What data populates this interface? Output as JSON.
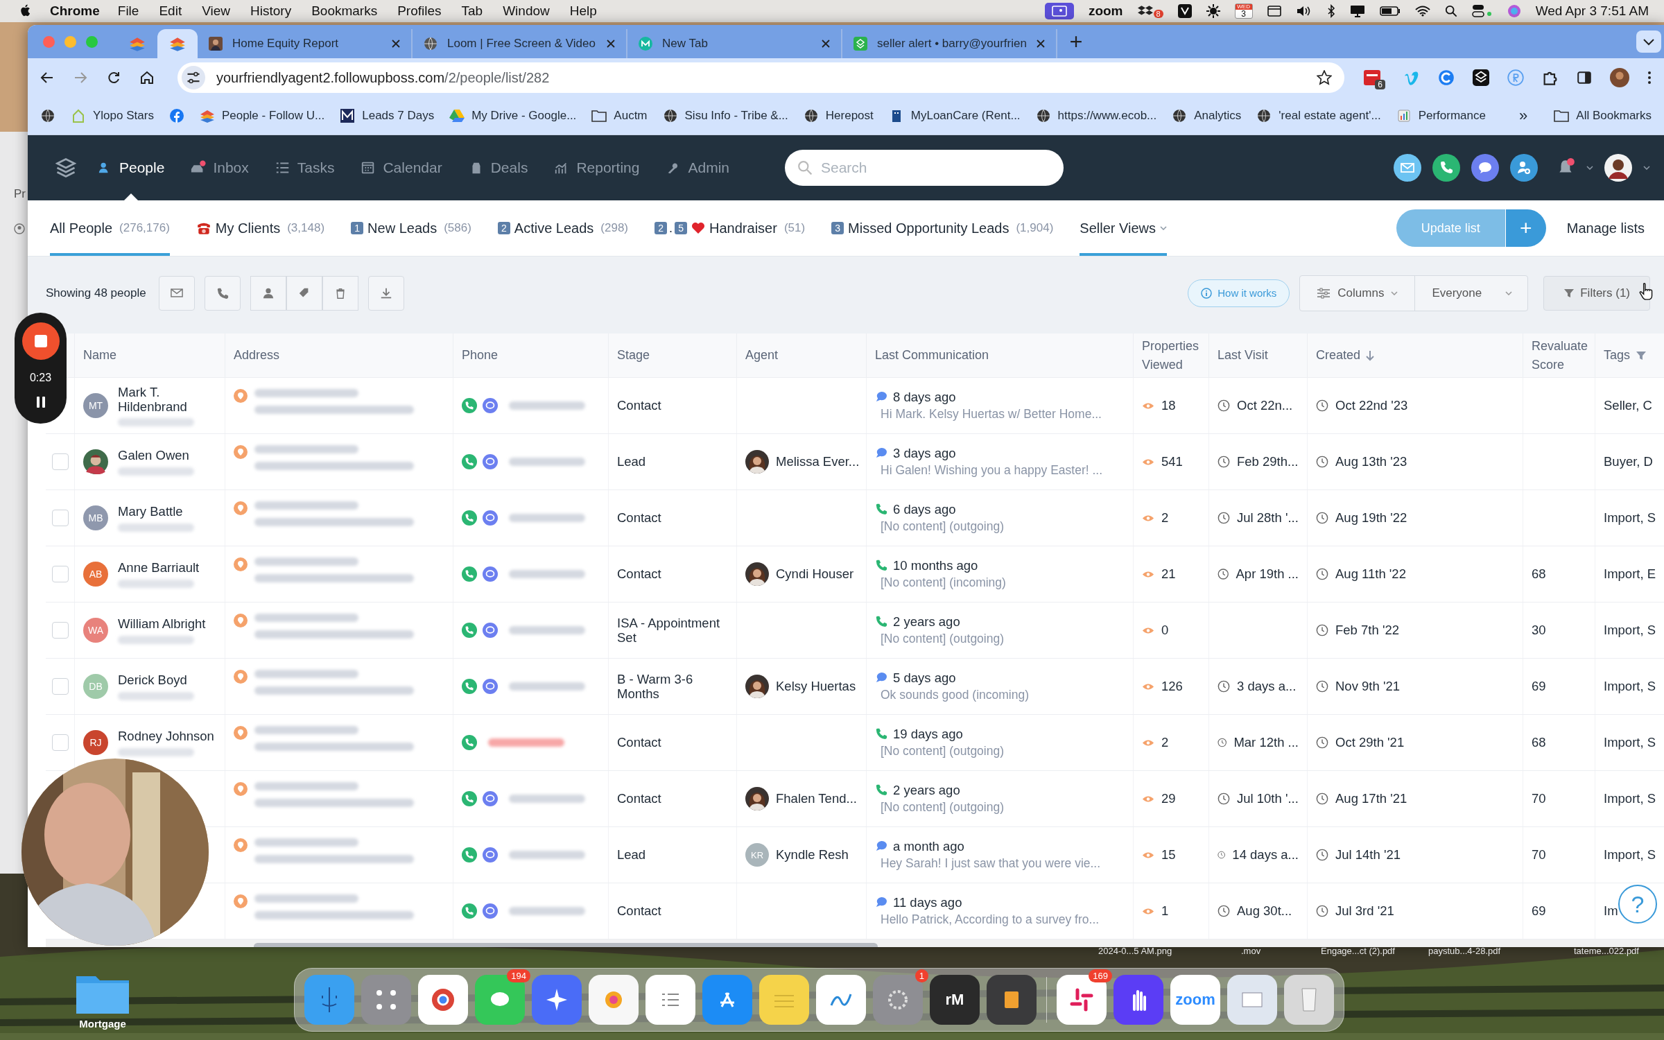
{
  "menu_bar": {
    "app": "Chrome",
    "items": [
      "File",
      "Edit",
      "View",
      "History",
      "Bookmarks",
      "Profiles",
      "Tab",
      "Window",
      "Help"
    ],
    "zoom": "zoom",
    "dropbox_badge": "8",
    "calendar_month": "WED",
    "calendar_day": "3",
    "clock": "Wed Apr 3  7:51 AM"
  },
  "background_window": {
    "text": "Pr"
  },
  "browser": {
    "tabs": [
      {
        "kind": "pinned",
        "selected": false
      },
      {
        "kind": "pinned",
        "selected": true
      },
      {
        "title": "Home Equity Report",
        "selected": false
      },
      {
        "kind": "globe",
        "title": "Loom | Free Screen & Video",
        "selected": false
      },
      {
        "kind": "m",
        "title": "New Tab",
        "selected": false
      },
      {
        "kind": "green",
        "title": "seller alert • barry@yourfrien",
        "selected": false
      }
    ],
    "url_host": "yourfriendlyagent2.followupboss.com",
    "url_path": "/2/people/list/282",
    "extension_badge": "6",
    "bookmarks": [
      {
        "kind": "globe"
      },
      {
        "kind": "house",
        "label": "Ylopo Stars"
      },
      {
        "kind": "facebook"
      },
      {
        "kind": "stack",
        "label": "People - Follow U..."
      },
      {
        "kind": "m",
        "label": "Leads 7 Days"
      },
      {
        "kind": "drive",
        "label": "My Drive - Google..."
      },
      {
        "kind": "folder",
        "label": "Auctm"
      },
      {
        "kind": "globe",
        "label": "Sisu Info - Tribe &..."
      },
      {
        "kind": "globe",
        "label": "Herepost"
      },
      {
        "kind": "building",
        "label": "MyLoanCare (Rent..."
      },
      {
        "kind": "globe",
        "label": "https://www.ecob..."
      },
      {
        "kind": "globe",
        "label": "Analytics"
      },
      {
        "kind": "globe",
        "label": "'real estate agent'..."
      },
      {
        "kind": "chart",
        "label": "Performance"
      }
    ],
    "bookmarks_more": "»",
    "all_bookmarks": "All Bookmarks"
  },
  "app_nav": {
    "items": [
      {
        "kind": "people",
        "label": "People",
        "selected": true,
        "dot": false
      },
      {
        "kind": "inbox",
        "label": "Inbox",
        "selected": false,
        "dot": true
      },
      {
        "kind": "tasks",
        "label": "Tasks",
        "selected": false,
        "dot": false
      },
      {
        "kind": "calendar",
        "label": "Calendar",
        "selected": false,
        "dot": false
      },
      {
        "kind": "deals",
        "label": "Deals",
        "selected": false,
        "dot": false
      },
      {
        "kind": "reporting",
        "label": "Reporting",
        "selected": false,
        "dot": false
      },
      {
        "kind": "admin",
        "label": "Admin",
        "selected": false,
        "dot": false
      }
    ],
    "search": {
      "placeholder": "Search"
    },
    "bell_dot": true
  },
  "list_tabs": [
    {
      "label": "All People",
      "count": "(276,176)",
      "selected": true,
      "dropdown": false
    },
    {
      "prefix": [
        {
          "kind": "phone"
        }
      ],
      "label": "My Clients",
      "count": "(3,148)",
      "selected": false,
      "dropdown": false
    },
    {
      "prefix": [
        {
          "kind": "key",
          "text": "1"
        }
      ],
      "label": "New Leads",
      "count": "(586)",
      "selected": false,
      "dropdown": false
    },
    {
      "prefix": [
        {
          "kind": "key",
          "text": "2"
        }
      ],
      "label": "Active Leads",
      "count": "(298)",
      "selected": false,
      "dropdown": false
    },
    {
      "prefix": [
        {
          "kind": "key",
          "text": "2"
        },
        {
          "kind": "text",
          "text": "."
        },
        {
          "kind": "key",
          "text": "5"
        },
        {
          "kind": "heart"
        }
      ],
      "label": "Handraiser",
      "count": "(51)",
      "selected": false,
      "dropdown": false
    },
    {
      "prefix": [
        {
          "kind": "key",
          "text": "3"
        }
      ],
      "label": "Missed Opportunity Leads",
      "count": "(1,904)",
      "selected": false,
      "dropdown": false
    },
    {
      "label": "Seller Views",
      "selected": true,
      "dropdown": true
    }
  ],
  "update_list": {
    "label": "Update list",
    "disabled": true
  },
  "add_button": "+",
  "manage_lists": "Manage lists",
  "toolbar": {
    "count": "Showing 48 people",
    "how_it_works": "How it works",
    "columns": "Columns",
    "everyone": "Everyone",
    "filters": "Filters (1)"
  },
  "table": {
    "columns": [
      {
        "label": "Name"
      },
      {
        "label": "Address"
      },
      {
        "label": "Phone"
      },
      {
        "label": "Stage"
      },
      {
        "label": "Agent"
      },
      {
        "label": "Last Communication"
      },
      {
        "label": "Properties Viewed"
      },
      {
        "label": "Last Visit"
      },
      {
        "label": "Created",
        "sorted": true
      },
      {
        "label": "Revaluate Score"
      },
      {
        "label": "Tags",
        "filter": true
      }
    ],
    "rows": [
      {
        "name": "Mark T. Hildenbrand",
        "avatar": {
          "kind": "initials",
          "text": "MT",
          "color": "#8a94a9"
        },
        "phone_valid": true,
        "stage": "Contact",
        "last_comm": {
          "kind": "message",
          "when": "8 days ago",
          "preview": "Hi Mark. Kelsy Huertas w/ Better Home..."
        },
        "properties_viewed": "18",
        "last_visit": "Oct 22n...",
        "created": "Oct 22nd '23",
        "tags": "Seller, C"
      },
      {
        "checked": false,
        "name": "Galen Owen",
        "phone_valid": true,
        "stage": "Lead",
        "agent": {
          "name": "Melissa Ever..."
        },
        "last_comm": {
          "kind": "message",
          "when": "3 days ago",
          "preview": "Hi Galen! Wishing you a happy Easter! ..."
        },
        "properties_viewed": "541",
        "last_visit": "Feb 29th...",
        "created": "Aug 13th '23",
        "tags": "Buyer, D"
      },
      {
        "checked": false,
        "name": "Mary Battle",
        "avatar": {
          "kind": "initials",
          "text": "MB",
          "color": "#8f98ad"
        },
        "phone_valid": true,
        "stage": "Contact",
        "last_comm": {
          "kind": "call",
          "when": "6 days ago",
          "preview": "[No content] (outgoing)"
        },
        "properties_viewed": "2",
        "last_visit": "Jul 28th '...",
        "created": "Aug 19th '22",
        "tags": "Import, S"
      },
      {
        "checked": false,
        "name": "Anne Barriault",
        "avatar": {
          "kind": "initials",
          "text": "AB",
          "color": "#e8703a"
        },
        "phone_valid": true,
        "stage": "Contact",
        "agent": {
          "name": "Cyndi Houser"
        },
        "last_comm": {
          "kind": "call",
          "when": "10 months ago",
          "preview": "[No content] (incoming)"
        },
        "properties_viewed": "21",
        "last_visit": "Apr 19th ...",
        "created": "Aug 11th '22",
        "revaluate_score": "68",
        "tags": "Import, E"
      },
      {
        "checked": false,
        "name": "William Albright",
        "avatar": {
          "kind": "initials",
          "text": "WA",
          "color": "#e8827c"
        },
        "phone_valid": true,
        "stage": "ISA - Appointment Set",
        "last_comm": {
          "kind": "call",
          "when": "2 years ago",
          "preview": "[No content] (outgoing)"
        },
        "properties_viewed": "0",
        "created": "Feb 7th '22",
        "revaluate_score": "30",
        "tags": "Import, S"
      },
      {
        "checked": false,
        "name": "Derick Boyd",
        "avatar": {
          "kind": "initials",
          "text": "DB",
          "color": "#9fcaa9"
        },
        "phone_valid": true,
        "stage": "B - Warm 3-6 Months",
        "agent": {
          "name": "Kelsy Huertas"
        },
        "last_comm": {
          "kind": "message",
          "when": "5 days ago",
          "preview": "Ok sounds good (incoming)"
        },
        "properties_viewed": "126",
        "last_visit": "3 days a...",
        "created": "Nov 9th '21",
        "revaluate_score": "69",
        "tags": "Import, S"
      },
      {
        "checked": false,
        "name": "Rodney Johnson",
        "avatar": {
          "kind": "initials",
          "text": "RJ",
          "color": "#c9452e"
        },
        "phone_valid": false,
        "stage": "Contact",
        "last_comm": {
          "kind": "call",
          "when": "19 days ago",
          "preview": "[No content] (outgoing)"
        },
        "properties_viewed": "2",
        "last_visit": "Mar 12th ...",
        "created": "Oct 29th '21",
        "revaluate_score": "68",
        "tags": "Import, S"
      },
      {
        "phone_valid": true,
        "stage": "Contact",
        "agent": {
          "name": "Fhalen Tend..."
        },
        "last_comm": {
          "kind": "call",
          "when": "2 years ago",
          "preview": "[No content] (outgoing)"
        },
        "properties_viewed": "29",
        "last_visit": "Jul 10th '...",
        "created": "Aug 17th '21",
        "revaluate_score": "70",
        "tags": "Import, S"
      },
      {
        "phone_valid": true,
        "stage": "Lead",
        "agent": {
          "name": "Kyndle Resh",
          "avatar": {
            "kind": "initials",
            "text": "KR",
            "color": "#a9b5ba"
          }
        },
        "last_comm": {
          "kind": "message",
          "when": "a month ago",
          "preview": "Hey Sarah! I just saw that you were vie..."
        },
        "properties_viewed": "15",
        "last_visit": "14 days a...",
        "created": "Jul 14th '21",
        "revaluate_score": "70",
        "tags": "Import, S"
      },
      {
        "phone_valid": true,
        "stage": "Contact",
        "last_comm": {
          "kind": "message",
          "when": "11 days ago",
          "preview": "Hello Patrick, According to a survey fro..."
        },
        "properties_viewed": "1",
        "last_visit": "Aug 30t...",
        "created": "Jul 3rd '21",
        "revaluate_score": "69",
        "tags": "Im"
      }
    ]
  },
  "help_button": "?",
  "loom": {
    "time": "0:23"
  },
  "desktop": {
    "folder_label": "Mortgage",
    "files": [
      "2024-0...5 AM.png",
      ".mov",
      "Engage...ct (2).pdf",
      "paystub...4-28.pdf",
      "tateme...022.pdf"
    ]
  },
  "dock": [
    {
      "kind": "finder"
    },
    {
      "kind": "launchpad"
    },
    {
      "kind": "chrome"
    },
    {
      "kind": "messages",
      "badge": "194"
    },
    {
      "kind": "star"
    },
    {
      "kind": "photos"
    },
    {
      "kind": "reminders"
    },
    {
      "kind": "appstore"
    },
    {
      "kind": "notes"
    },
    {
      "kind": "freeform"
    },
    {
      "kind": "settings",
      "badge": "1"
    },
    {
      "kind": "label",
      "label": "rM"
    },
    {
      "kind": "calculator"
    },
    {
      "kind": "divider"
    },
    {
      "kind": "slack",
      "badge": "169"
    },
    {
      "kind": "hand"
    },
    {
      "kind": "zoom",
      "label": "zoom"
    },
    {
      "kind": "preview"
    },
    {
      "kind": "trash"
    }
  ]
}
